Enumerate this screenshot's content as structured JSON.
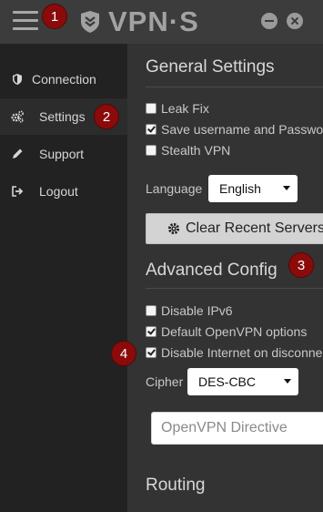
{
  "titlebar": {
    "logo_text": "VPN·S",
    "menu_icon": "hamburger-menu-icon",
    "logo_icon": "shield-chevron-icon",
    "minimize_icon": "minimize-icon",
    "close_icon": "close-icon"
  },
  "sidebar": {
    "items": [
      {
        "label": "Connection",
        "icon": "shield-icon",
        "active": false
      },
      {
        "label": "Settings",
        "icon": "gears-icon",
        "active": true
      },
      {
        "label": "Support",
        "icon": "pencil-icon",
        "active": false
      },
      {
        "label": "Logout",
        "icon": "sign-out-icon",
        "active": false
      }
    ]
  },
  "general": {
    "title": "General Settings",
    "options": [
      {
        "label": "Leak Fix",
        "checked": false
      },
      {
        "label": "Save username and Password",
        "checked": true
      },
      {
        "label": "Stealth VPN",
        "checked": false
      }
    ],
    "language_label": "Language",
    "language_value": "English",
    "clear_button": "Clear Recent Servers"
  },
  "advanced": {
    "title": "Advanced Config",
    "options": [
      {
        "label": "Disable IPv6",
        "checked": false
      },
      {
        "label": "Default OpenVPN options",
        "checked": true
      },
      {
        "label": "Disable Internet on disconnect",
        "checked": true
      }
    ],
    "cipher_label": "Cipher",
    "cipher_value": "DES-CBC",
    "directive_placeholder": "OpenVPN Directive"
  },
  "routing": {
    "title": "Routing"
  },
  "markers": [
    "1",
    "2",
    "3",
    "4"
  ],
  "colors": {
    "accent_marker": "#8b0b0b",
    "sidebar_bg": "#222222",
    "panel_bg": "#333333",
    "titlebar_bg": "#3c3c3c"
  }
}
